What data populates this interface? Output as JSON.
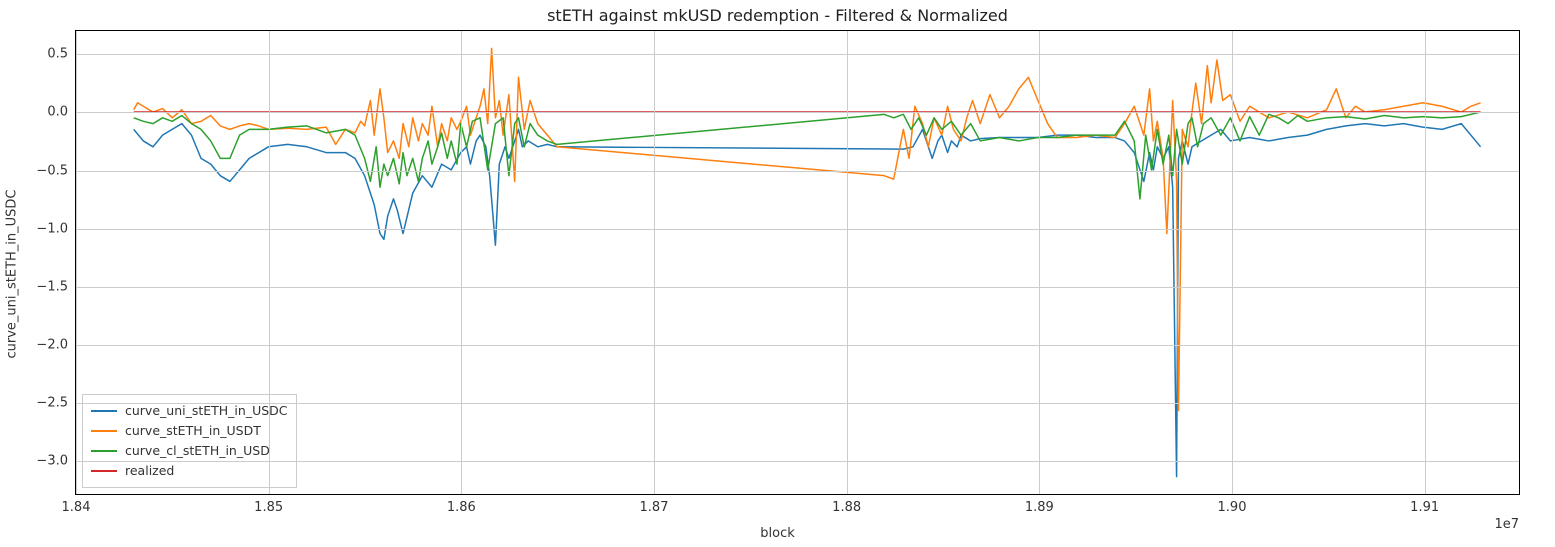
{
  "chart_data": {
    "type": "line",
    "title": "stETH against mkUSD redemption - Filtered & Normalized",
    "xlabel": "block",
    "ylabel": "curve_uni_stETH_in_USDC",
    "xlim": [
      18400000.0,
      19150000.0
    ],
    "ylim": [
      -3.3,
      0.7
    ],
    "x_offset_text": "1e7",
    "x_ticks": [
      1.84,
      1.85,
      1.86,
      1.87,
      1.88,
      1.89,
      1.9,
      1.91
    ],
    "y_ticks": [
      -3.0,
      -2.5,
      -2.0,
      -1.5,
      -1.0,
      -0.5,
      0.0,
      0.5
    ],
    "x_tick_labels": [
      "1.84",
      "1.85",
      "1.86",
      "1.87",
      "1.88",
      "1.89",
      "1.90",
      "1.91"
    ],
    "y_tick_labels": [
      "−3.0",
      "−2.5",
      "−2.0",
      "−1.5",
      "−1.0",
      "−0.5",
      "0.0",
      "0.5"
    ],
    "legend": {
      "position": "lower left",
      "entries": [
        "curve_uni_stETH_in_USDC",
        "curve_stETH_in_USDT",
        "curve_cl_stETH_in_USD",
        "realized"
      ]
    },
    "colors": {
      "curve_uni_stETH_in_USDC": "#1f77b4",
      "curve_stETH_in_USDT": "#ff7f0e",
      "curve_cl_stETH_in_USD": "#2ca02c",
      "realized": "#d62728"
    },
    "series": [
      {
        "name": "curve_uni_stETH_in_USDC",
        "x": [
          1.843,
          1.8435,
          1.844,
          1.8445,
          1.845,
          1.8455,
          1.846,
          1.8465,
          1.847,
          1.8475,
          1.848,
          1.8485,
          1.849,
          1.85,
          1.851,
          1.852,
          1.853,
          1.854,
          1.8545,
          1.855,
          1.8555,
          1.8558,
          1.856,
          1.8562,
          1.8565,
          1.8567,
          1.857,
          1.8575,
          1.858,
          1.8585,
          1.859,
          1.8595,
          1.86,
          1.8603,
          1.8605,
          1.8608,
          1.861,
          1.8613,
          1.8615,
          1.8618,
          1.862,
          1.8623,
          1.8625,
          1.8628,
          1.863,
          1.8632,
          1.8635,
          1.864,
          1.8645,
          1.865,
          1.883,
          1.8835,
          1.884,
          1.8843,
          1.8845,
          1.8848,
          1.885,
          1.8853,
          1.8855,
          1.8858,
          1.886,
          1.8865,
          1.887,
          1.888,
          1.889,
          1.89,
          1.891,
          1.892,
          1.893,
          1.894,
          1.8945,
          1.895,
          1.8955,
          1.8958,
          1.896,
          1.8962,
          1.8965,
          1.8968,
          1.897,
          1.8972,
          1.8973,
          1.8975,
          1.8978,
          1.898,
          1.8985,
          1.899,
          1.8995,
          1.9,
          1.901,
          1.902,
          1.903,
          1.904,
          1.905,
          1.906,
          1.907,
          1.908,
          1.909,
          1.91,
          1.911,
          1.912,
          1.913
        ],
        "y": [
          -0.15,
          -0.25,
          -0.3,
          -0.2,
          -0.15,
          -0.1,
          -0.2,
          -0.4,
          -0.45,
          -0.55,
          -0.6,
          -0.5,
          -0.4,
          -0.3,
          -0.28,
          -0.3,
          -0.35,
          -0.35,
          -0.4,
          -0.55,
          -0.8,
          -1.05,
          -1.1,
          -0.9,
          -0.75,
          -0.85,
          -1.05,
          -0.7,
          -0.55,
          -0.65,
          -0.45,
          -0.5,
          -0.35,
          -0.3,
          -0.45,
          -0.25,
          -0.2,
          -0.3,
          -0.55,
          -1.15,
          -0.45,
          -0.3,
          -0.4,
          -0.25,
          -0.15,
          -0.3,
          -0.25,
          -0.3,
          -0.28,
          -0.3,
          -0.32,
          -0.3,
          -0.15,
          -0.3,
          -0.4,
          -0.25,
          -0.2,
          -0.35,
          -0.25,
          -0.3,
          -0.2,
          -0.25,
          -0.23,
          -0.22,
          -0.22,
          -0.22,
          -0.2,
          -0.2,
          -0.22,
          -0.22,
          -0.25,
          -0.35,
          -0.6,
          -0.35,
          -0.5,
          -0.3,
          -0.4,
          -0.3,
          -0.65,
          -3.15,
          -0.4,
          -0.25,
          -0.45,
          -0.3,
          -0.25,
          -0.2,
          -0.15,
          -0.25,
          -0.22,
          -0.25,
          -0.22,
          -0.2,
          -0.15,
          -0.12,
          -0.1,
          -0.12,
          -0.1,
          -0.13,
          -0.15,
          -0.1,
          -0.3
        ]
      },
      {
        "name": "curve_stETH_in_USDT",
        "x": [
          1.843,
          1.8432,
          1.8435,
          1.844,
          1.8445,
          1.845,
          1.8455,
          1.846,
          1.8465,
          1.847,
          1.8475,
          1.848,
          1.8485,
          1.849,
          1.8495,
          1.85,
          1.851,
          1.852,
          1.853,
          1.8535,
          1.854,
          1.8545,
          1.8548,
          1.855,
          1.8553,
          1.8555,
          1.8558,
          1.856,
          1.8562,
          1.8565,
          1.8568,
          1.857,
          1.8573,
          1.8575,
          1.8578,
          1.858,
          1.8583,
          1.8585,
          1.8588,
          1.859,
          1.8593,
          1.8595,
          1.8598,
          1.86,
          1.8603,
          1.8605,
          1.8608,
          1.861,
          1.8612,
          1.8614,
          1.8616,
          1.8618,
          1.862,
          1.8622,
          1.8625,
          1.8628,
          1.863,
          1.8633,
          1.8636,
          1.864,
          1.8645,
          1.865,
          1.882,
          1.8825,
          1.883,
          1.8833,
          1.8836,
          1.884,
          1.8843,
          1.8846,
          1.885,
          1.8853,
          1.8856,
          1.886,
          1.8863,
          1.8866,
          1.887,
          1.8875,
          1.888,
          1.8885,
          1.889,
          1.8895,
          1.89,
          1.8905,
          1.891,
          1.892,
          1.893,
          1.894,
          1.8945,
          1.895,
          1.8955,
          1.8958,
          1.896,
          1.8962,
          1.8965,
          1.8967,
          1.897,
          1.8972,
          1.8973,
          1.8975,
          1.8978,
          1.898,
          1.8982,
          1.8985,
          1.8988,
          1.899,
          1.8993,
          1.8996,
          1.9,
          1.9005,
          1.901,
          1.902,
          1.903,
          1.904,
          1.905,
          1.9055,
          1.906,
          1.9065,
          1.907,
          1.908,
          1.909,
          1.91,
          1.911,
          1.912,
          1.9125,
          1.913
        ],
        "y": [
          0.02,
          0.08,
          0.05,
          0.0,
          0.03,
          -0.05,
          0.02,
          -0.1,
          -0.08,
          -0.03,
          -0.12,
          -0.15,
          -0.12,
          -0.1,
          -0.12,
          -0.15,
          -0.14,
          -0.15,
          -0.13,
          -0.28,
          -0.15,
          -0.18,
          -0.08,
          -0.12,
          0.1,
          -0.2,
          0.2,
          -0.05,
          -0.35,
          -0.25,
          -0.4,
          -0.1,
          -0.3,
          -0.05,
          -0.25,
          -0.1,
          -0.2,
          0.05,
          -0.3,
          -0.1,
          -0.25,
          -0.05,
          -0.15,
          -0.08,
          0.05,
          -0.2,
          -0.05,
          0.05,
          0.2,
          -0.1,
          0.55,
          -0.05,
          0.1,
          -0.2,
          0.15,
          -0.6,
          0.3,
          -0.15,
          0.1,
          -0.1,
          -0.2,
          -0.3,
          -0.55,
          -0.58,
          -0.15,
          -0.4,
          0.05,
          -0.1,
          -0.3,
          -0.05,
          -0.2,
          0.05,
          -0.15,
          -0.25,
          -0.05,
          0.1,
          -0.1,
          0.15,
          -0.05,
          0.05,
          0.2,
          0.3,
          0.1,
          -0.1,
          -0.22,
          -0.22,
          -0.2,
          -0.22,
          -0.1,
          0.05,
          -0.2,
          0.2,
          -0.25,
          -0.08,
          -0.4,
          -1.05,
          0.1,
          -0.6,
          -2.58,
          -0.15,
          -0.3,
          0.0,
          0.25,
          -0.1,
          0.4,
          0.08,
          0.45,
          0.1,
          0.15,
          -0.08,
          0.05,
          -0.05,
          0.0,
          -0.05,
          0.02,
          0.2,
          -0.05,
          0.05,
          0.0,
          0.02,
          0.05,
          0.08,
          0.05,
          0.0,
          0.05,
          0.08
        ]
      },
      {
        "name": "curve_cl_stETH_in_USD",
        "x": [
          1.843,
          1.8435,
          1.844,
          1.8445,
          1.845,
          1.8455,
          1.846,
          1.8465,
          1.847,
          1.8475,
          1.848,
          1.8485,
          1.849,
          1.85,
          1.851,
          1.852,
          1.853,
          1.854,
          1.8545,
          1.855,
          1.8553,
          1.8556,
          1.8558,
          1.856,
          1.8562,
          1.8565,
          1.8568,
          1.857,
          1.8572,
          1.8575,
          1.8578,
          1.858,
          1.8583,
          1.8585,
          1.8588,
          1.859,
          1.8593,
          1.8595,
          1.8598,
          1.86,
          1.8603,
          1.8606,
          1.861,
          1.8614,
          1.8618,
          1.8622,
          1.8625,
          1.8628,
          1.863,
          1.8633,
          1.8636,
          1.864,
          1.8645,
          1.865,
          1.882,
          1.8825,
          1.883,
          1.8834,
          1.8838,
          1.8842,
          1.8846,
          1.885,
          1.8855,
          1.886,
          1.8865,
          1.887,
          1.888,
          1.889,
          1.89,
          1.891,
          1.892,
          1.893,
          1.894,
          1.8945,
          1.895,
          1.8953,
          1.8956,
          1.8959,
          1.8962,
          1.8965,
          1.8968,
          1.897,
          1.8972,
          1.8975,
          1.8978,
          1.898,
          1.8983,
          1.8986,
          1.899,
          1.8995,
          1.9,
          1.9005,
          1.901,
          1.9015,
          1.902,
          1.9025,
          1.903,
          1.9035,
          1.904,
          1.905,
          1.906,
          1.907,
          1.908,
          1.909,
          1.91,
          1.911,
          1.912,
          1.913
        ],
        "y": [
          -0.05,
          -0.08,
          -0.1,
          -0.05,
          -0.08,
          -0.03,
          -0.1,
          -0.15,
          -0.25,
          -0.4,
          -0.4,
          -0.2,
          -0.15,
          -0.15,
          -0.13,
          -0.12,
          -0.18,
          -0.15,
          -0.2,
          -0.4,
          -0.6,
          -0.3,
          -0.65,
          -0.45,
          -0.55,
          -0.4,
          -0.62,
          -0.35,
          -0.55,
          -0.4,
          -0.6,
          -0.4,
          -0.25,
          -0.45,
          -0.3,
          -0.18,
          -0.4,
          -0.25,
          -0.45,
          -0.1,
          -0.3,
          -0.08,
          -0.05,
          -0.5,
          -0.1,
          -0.05,
          -0.55,
          -0.1,
          -0.05,
          -0.3,
          -0.1,
          -0.2,
          -0.25,
          -0.28,
          -0.02,
          -0.05,
          -0.02,
          -0.15,
          -0.05,
          -0.2,
          -0.05,
          -0.15,
          -0.08,
          -0.2,
          -0.1,
          -0.25,
          -0.22,
          -0.25,
          -0.22,
          -0.22,
          -0.2,
          -0.2,
          -0.2,
          -0.08,
          -0.25,
          -0.75,
          -0.2,
          -0.5,
          -0.15,
          -0.45,
          -0.2,
          -0.55,
          -0.15,
          -0.45,
          -0.1,
          -0.05,
          -0.3,
          -0.1,
          -0.05,
          -0.2,
          -0.05,
          -0.25,
          -0.04,
          -0.2,
          -0.02,
          -0.05,
          -0.1,
          -0.03,
          -0.08,
          -0.05,
          -0.04,
          -0.06,
          -0.03,
          -0.05,
          -0.04,
          -0.05,
          -0.04,
          0.0
        ]
      },
      {
        "name": "realized",
        "x": [
          1.843,
          1.913
        ],
        "y": [
          0.0,
          0.0
        ]
      }
    ]
  }
}
